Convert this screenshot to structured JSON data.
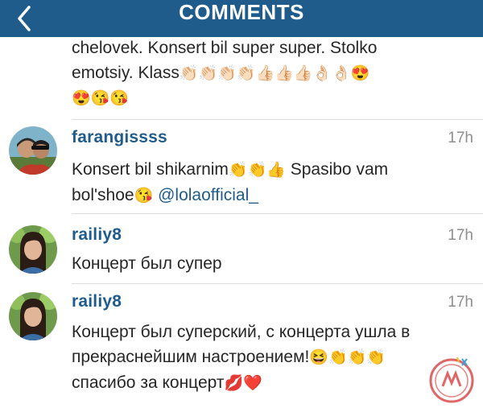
{
  "header": {
    "title": "COMMENTS"
  },
  "comments": [
    {
      "username": "",
      "time": "",
      "line1": "chelovek. Konsert bil super super. Stolko",
      "line2_text": "emotsiy. Klass",
      "line2_emoji": "👏🏻👏🏻👏🏻👏🏻👍🏻👍🏻👍🏻👌🏻👌🏻😍",
      "line3_emoji": "😍😘😘"
    },
    {
      "username": "farangissss",
      "time": "17h",
      "line1_text": "Konsert bil shikarnim",
      "line1_emoji": "👏👏👍",
      "line1_text2": " Spasibo vam",
      "line2_text": "bol'shoe",
      "line2_emoji": "😘",
      "mention": "@lolaofficial_"
    },
    {
      "username": "railiy8",
      "time": "17h",
      "line1": "Концерт был супер"
    },
    {
      "username": "railiy8",
      "time": "17h",
      "line1": "Концерт был суперский, с концерта ушла  в",
      "line2_text": "прекраснейшим настроением!",
      "line2_emoji": "😆👏👏👏",
      "line3_text": "спасибо за концерт",
      "line3_emoji": "💋❤️"
    }
  ]
}
